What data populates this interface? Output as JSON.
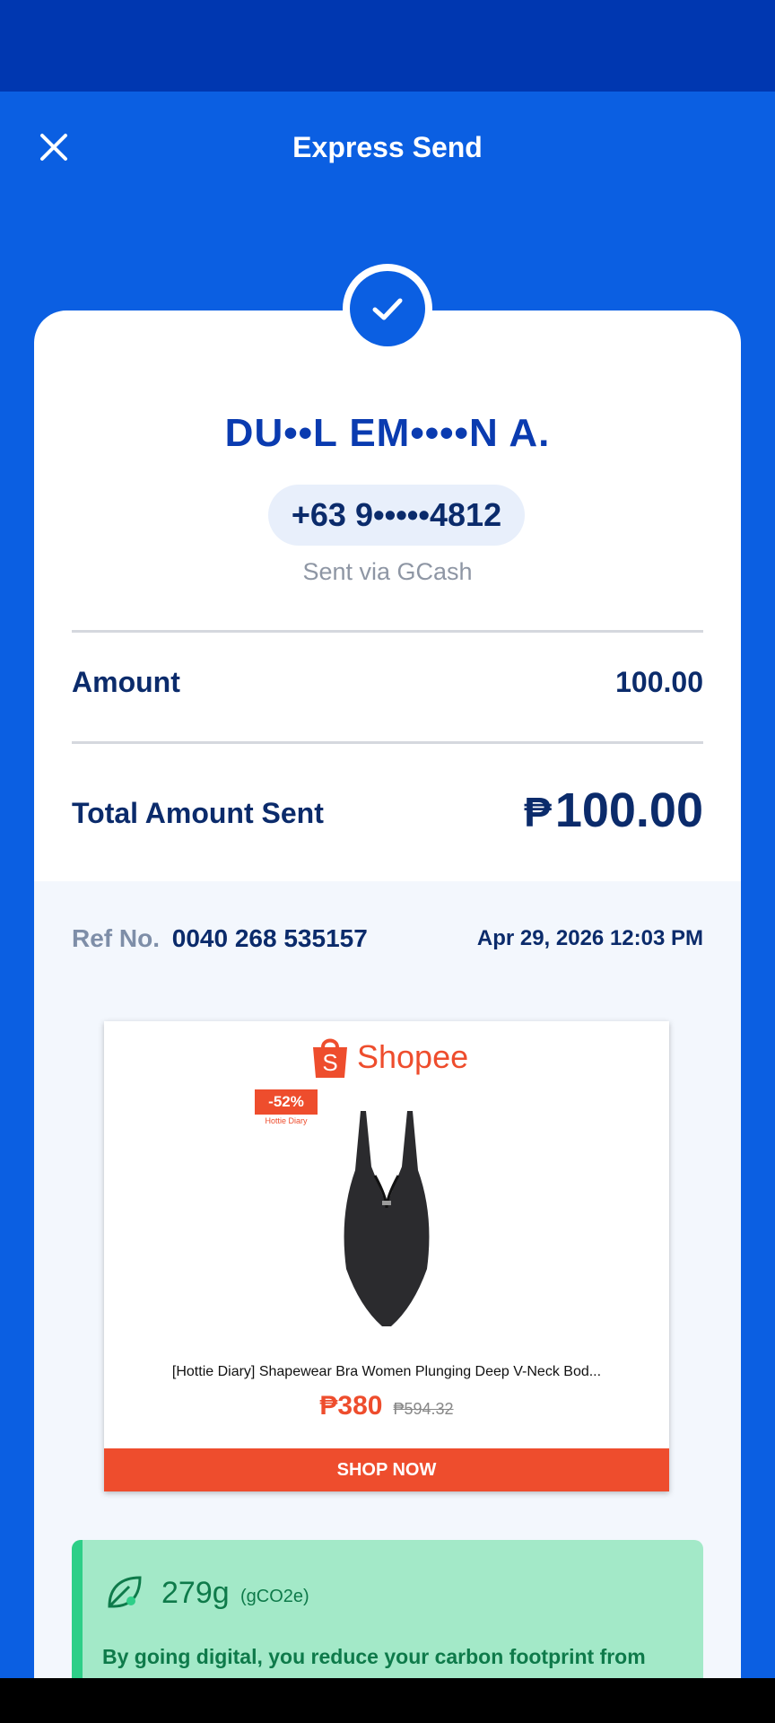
{
  "header": {
    "title": "Express Send"
  },
  "recipient": {
    "name": "DU••L EM••••N A.",
    "phone": "+63 9•••••4812",
    "sent_via": "Sent via GCash"
  },
  "amount": {
    "label": "Amount",
    "value": "100.00"
  },
  "total": {
    "label": "Total Amount Sent",
    "currency": "₱",
    "value": "100.00"
  },
  "reference": {
    "label": "Ref No.",
    "number": "0040 268 535157",
    "date": "Apr 29, 2026 12:03 PM"
  },
  "ad": {
    "brand": "Shopee",
    "discount": "-52%",
    "mini_brand": "Hottie Diary",
    "product_name": "[Hottie Diary] Shapewear Bra Women Plunging Deep V-Neck Bod...",
    "price": "₱380",
    "old_price": "₱594.32",
    "cta": "SHOP NOW"
  },
  "carbon": {
    "value": "279g",
    "unit": "(gCO2e)",
    "text": "By going digital, you reduce your carbon footprint from transportation, paper and plastic."
  },
  "colors": {
    "brand_blue": "#0b5fe2",
    "status_bar": "#0037b0",
    "navy_text": "#0b2b6b",
    "shopee_orange": "#ee4d2d",
    "carbon_green_bg": "#a3e9c8",
    "carbon_green_text": "#0e7a4a"
  },
  "icons": {
    "close": "close-icon",
    "check": "check-icon",
    "shopee_bag": "shopping-bag-icon",
    "leaf": "leaf-icon"
  }
}
